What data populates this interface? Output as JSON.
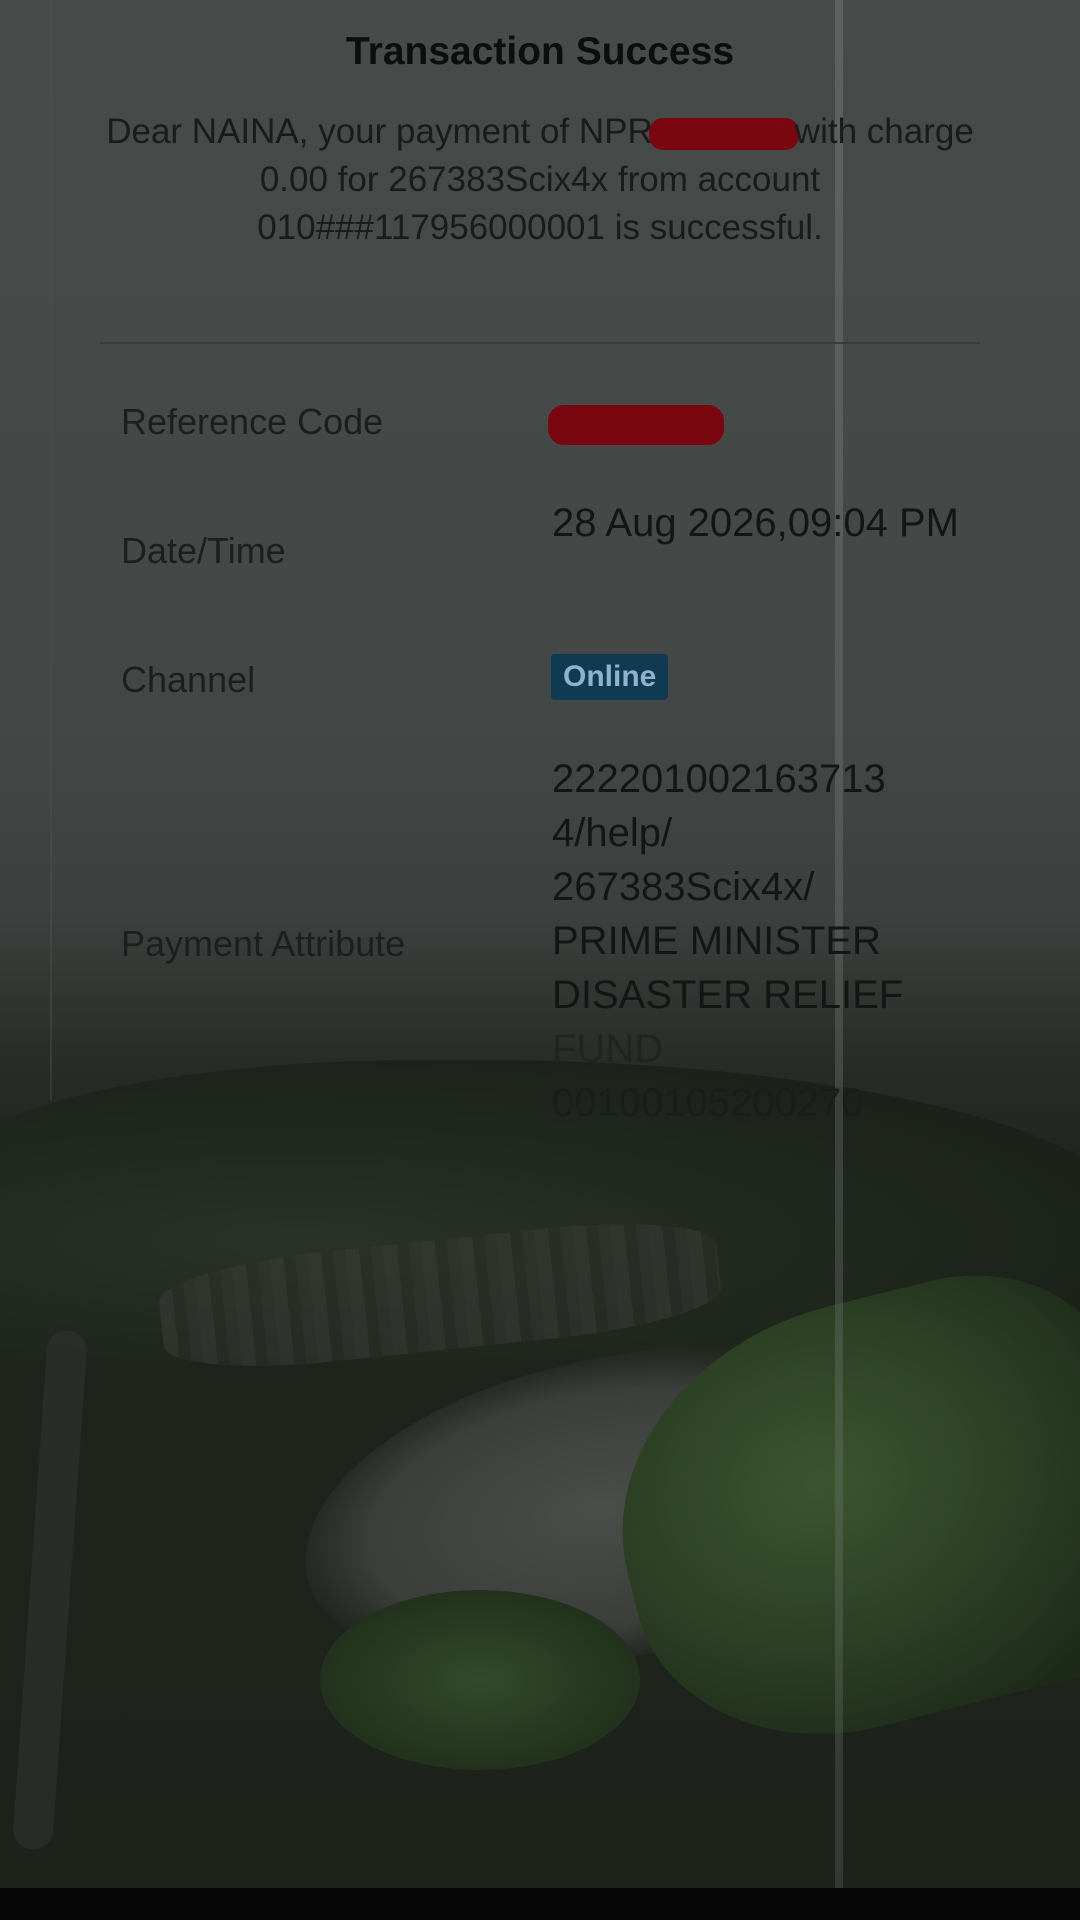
{
  "receipt": {
    "title": "Transaction Success",
    "message": {
      "part1": "Dear NAINA, your payment of NPR",
      "part2": "with charge 0.00 for 267383Scix4x from account 010###117956000001 is successful."
    },
    "fields": {
      "reference_label": "Reference Code",
      "datetime_label": "Date/Time",
      "datetime_value": "28 Aug 2026,09:04 PM",
      "channel_label": "Channel",
      "channel_value": "Online",
      "payment_attribute_label": "Payment Attribute",
      "payment_attribute_lines": [
        "222201002163713",
        "4/help/",
        "267383Scix4x/",
        "PRIME MINISTER",
        "DISASTER RELIEF",
        "FUND",
        "00100105200270"
      ]
    }
  },
  "colors": {
    "badge_background": "#0f3a51",
    "redaction": "#7a0710"
  }
}
